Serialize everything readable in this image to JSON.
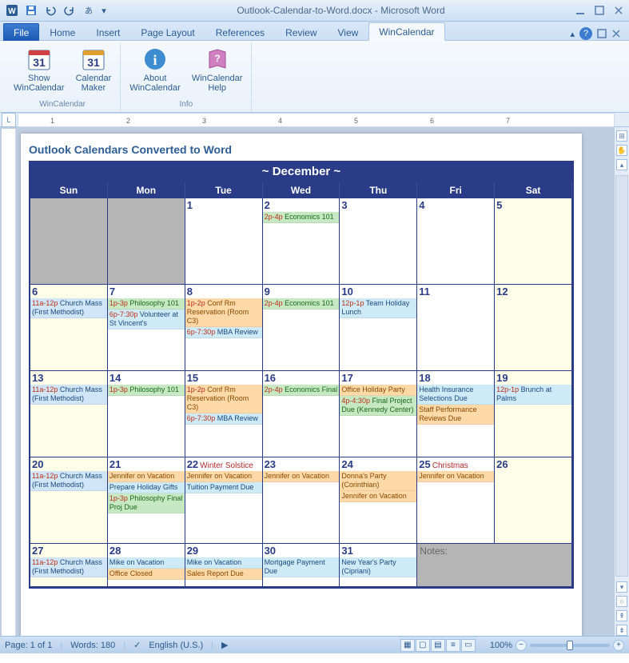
{
  "title": "Outlook-Calendar-to-Word.docx - Microsoft Word",
  "tabs": {
    "file": "File",
    "home": "Home",
    "insert": "Insert",
    "pagelayout": "Page Layout",
    "references": "References",
    "review": "Review",
    "view": "View",
    "wc": "WinCalendar"
  },
  "ribbon": {
    "g1": {
      "title": "WinCalendar",
      "b1": "Show\nWinCalendar",
      "b2": "Calendar\nMaker"
    },
    "g2": {
      "title": "Info",
      "b1": "About\nWinCalendar",
      "b2": "WinCalendar\nHelp"
    }
  },
  "ruler": {
    "marks": [
      "1",
      "2",
      "3",
      "4",
      "5",
      "6",
      "7"
    ]
  },
  "doc": {
    "heading": "Outlook Calendars Converted to Word"
  },
  "cal": {
    "month": "~ December ~",
    "days": [
      "Sun",
      "Mon",
      "Tue",
      "Wed",
      "Thu",
      "Fri",
      "Sat"
    ],
    "notes_label": "Notes:",
    "cells": [
      {
        "n": "",
        "out": true
      },
      {
        "n": "",
        "out": true
      },
      {
        "n": "1"
      },
      {
        "n": "2",
        "ev": [
          {
            "c": "green",
            "t": "2p-4p",
            "x": "Economics 101"
          }
        ]
      },
      {
        "n": "3"
      },
      {
        "n": "4"
      },
      {
        "n": "5",
        "wk": true
      },
      {
        "n": "6",
        "wk": true,
        "ev": [
          {
            "c": "blue",
            "t": "11a-12p",
            "x": "Church Mass (First Methodist)"
          }
        ]
      },
      {
        "n": "7",
        "ev": [
          {
            "c": "green",
            "t": "1p-3p",
            "x": "Philosophy 101"
          },
          {
            "c": "lblue",
            "t": "6p-7:30p",
            "x": "Volunteer at St Vincent's"
          }
        ]
      },
      {
        "n": "8",
        "ev": [
          {
            "c": "orange",
            "t": "1p-2p",
            "x": "Conf Rm Reservation (Room C3)"
          },
          {
            "c": "lblue",
            "t": "6p-7:30p",
            "x": "MBA Review"
          }
        ]
      },
      {
        "n": "9",
        "ev": [
          {
            "c": "green",
            "t": "2p-4p",
            "x": "Economics 101"
          }
        ]
      },
      {
        "n": "10",
        "ev": [
          {
            "c": "lblue",
            "t": "12p-1p",
            "x": "Team Holiday Lunch"
          }
        ]
      },
      {
        "n": "11"
      },
      {
        "n": "12",
        "wk": true
      },
      {
        "n": "13",
        "wk": true,
        "ev": [
          {
            "c": "blue",
            "t": "11a-12p",
            "x": "Church Mass (First Methodist)"
          }
        ]
      },
      {
        "n": "14",
        "ev": [
          {
            "c": "green",
            "t": "1p-3p",
            "x": "Philosophy 101"
          }
        ]
      },
      {
        "n": "15",
        "ev": [
          {
            "c": "orange",
            "t": "1p-2p",
            "x": "Conf Rm Reservation (Room C3)"
          },
          {
            "c": "lblue",
            "t": "6p-7:30p",
            "x": "MBA Review"
          }
        ]
      },
      {
        "n": "16",
        "ev": [
          {
            "c": "green",
            "t": "2p-4p",
            "x": "Economics Final"
          }
        ]
      },
      {
        "n": "17",
        "ev": [
          {
            "c": "orange",
            "t": "",
            "x": "Office Holiday Party"
          },
          {
            "c": "green",
            "t": "4p-4:30p",
            "x": "Final Project Due (Kennedy Center)"
          }
        ]
      },
      {
        "n": "18",
        "ev": [
          {
            "c": "lblue",
            "t": "",
            "x": "Health Insurance Selections Due"
          },
          {
            "c": "orange",
            "t": "",
            "x": "Staff Performance Reviews Due"
          }
        ]
      },
      {
        "n": "19",
        "wk": true,
        "ev": [
          {
            "c": "lblue",
            "t": "12p-1p",
            "x": "Brunch at Palms"
          }
        ]
      },
      {
        "n": "20",
        "wk": true,
        "ev": [
          {
            "c": "blue",
            "t": "11a-12p",
            "x": "Church Mass (First Methodist)"
          }
        ]
      },
      {
        "n": "21",
        "ev": [
          {
            "c": "orange",
            "t": "",
            "x": "Jennifer on Vacation"
          },
          {
            "c": "lblue",
            "t": "",
            "x": "Prepare Holiday Gifts"
          },
          {
            "c": "green",
            "t": "1p-3p",
            "x": "Philosophy Final Proj Due"
          }
        ]
      },
      {
        "n": "22",
        "hol": "Winter Solstice",
        "ev": [
          {
            "c": "orange",
            "t": "",
            "x": "Jennifer on Vacation"
          },
          {
            "c": "lblue",
            "t": "",
            "x": "Tuition Payment Due"
          }
        ]
      },
      {
        "n": "23",
        "ev": [
          {
            "c": "orange",
            "t": "",
            "x": "Jennifer on Vacation"
          }
        ]
      },
      {
        "n": "24",
        "ev": [
          {
            "c": "orange",
            "t": "",
            "x": "Donna's Party (Corinthian)"
          },
          {
            "c": "orange",
            "t": "",
            "x": "Jennifer on Vacation"
          }
        ]
      },
      {
        "n": "25",
        "hol": "Christmas",
        "ev": [
          {
            "c": "orange",
            "t": "",
            "x": "Jennifer on Vacation"
          }
        ]
      },
      {
        "n": "26",
        "wk": true
      },
      {
        "n": "27",
        "wk": true,
        "ev": [
          {
            "c": "blue",
            "t": "11a-12p",
            "x": "Church Mass (First Methodist)"
          }
        ]
      },
      {
        "n": "28",
        "ev": [
          {
            "c": "lblue",
            "t": "",
            "x": "Mike on Vacation"
          },
          {
            "c": "orange",
            "t": "",
            "x": "Office Closed"
          }
        ]
      },
      {
        "n": "29",
        "ev": [
          {
            "c": "lblue",
            "t": "",
            "x": "Mike on Vacation"
          },
          {
            "c": "orange",
            "t": "",
            "x": "Sales Report Due"
          }
        ]
      },
      {
        "n": "30",
        "ev": [
          {
            "c": "lblue",
            "t": "",
            "x": "Mortgage Payment Due"
          }
        ]
      },
      {
        "n": "31",
        "ev": [
          {
            "c": "lblue",
            "t": "",
            "x": "New Year's Party (Cipriani)"
          }
        ]
      },
      {
        "notes": true,
        "out": true
      }
    ]
  },
  "status": {
    "page": "Page: 1 of 1",
    "words": "Words: 180",
    "lang": "English (U.S.)",
    "zoom": "100%"
  }
}
